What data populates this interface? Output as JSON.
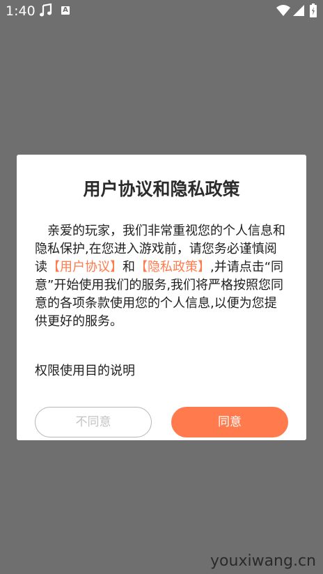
{
  "status_bar": {
    "time": "1:40",
    "badge_letter": "A",
    "icons": [
      "music-icon",
      "a-icon",
      "wifi-icon",
      "signal-icon",
      "battery-icon"
    ]
  },
  "dialog": {
    "title": "用户协议和隐私政策",
    "body": {
      "part1": "亲爱的玩家，我们非常重视您的个人信息和隐私保护,在您进入游戏前，请您务必谨慎阅读",
      "link_user": "【用户协议】",
      "and": "和",
      "link_privacy": "【隐私政策】",
      "part2": ",并请点击“同意”开始使用我们的服务,我们将严格按照您同意的各项条款使用您的个人信息,以便为您提供更好的服务。"
    },
    "permission_label": "权限使用目的说明",
    "buttons": {
      "disagree": "不同意",
      "agree": "同意"
    }
  },
  "colors": {
    "accent": "#ff7a4d",
    "overlay": "#6f6f6f",
    "dialog_bg": "#ffffff"
  },
  "watermark": "youxiwang.cn"
}
